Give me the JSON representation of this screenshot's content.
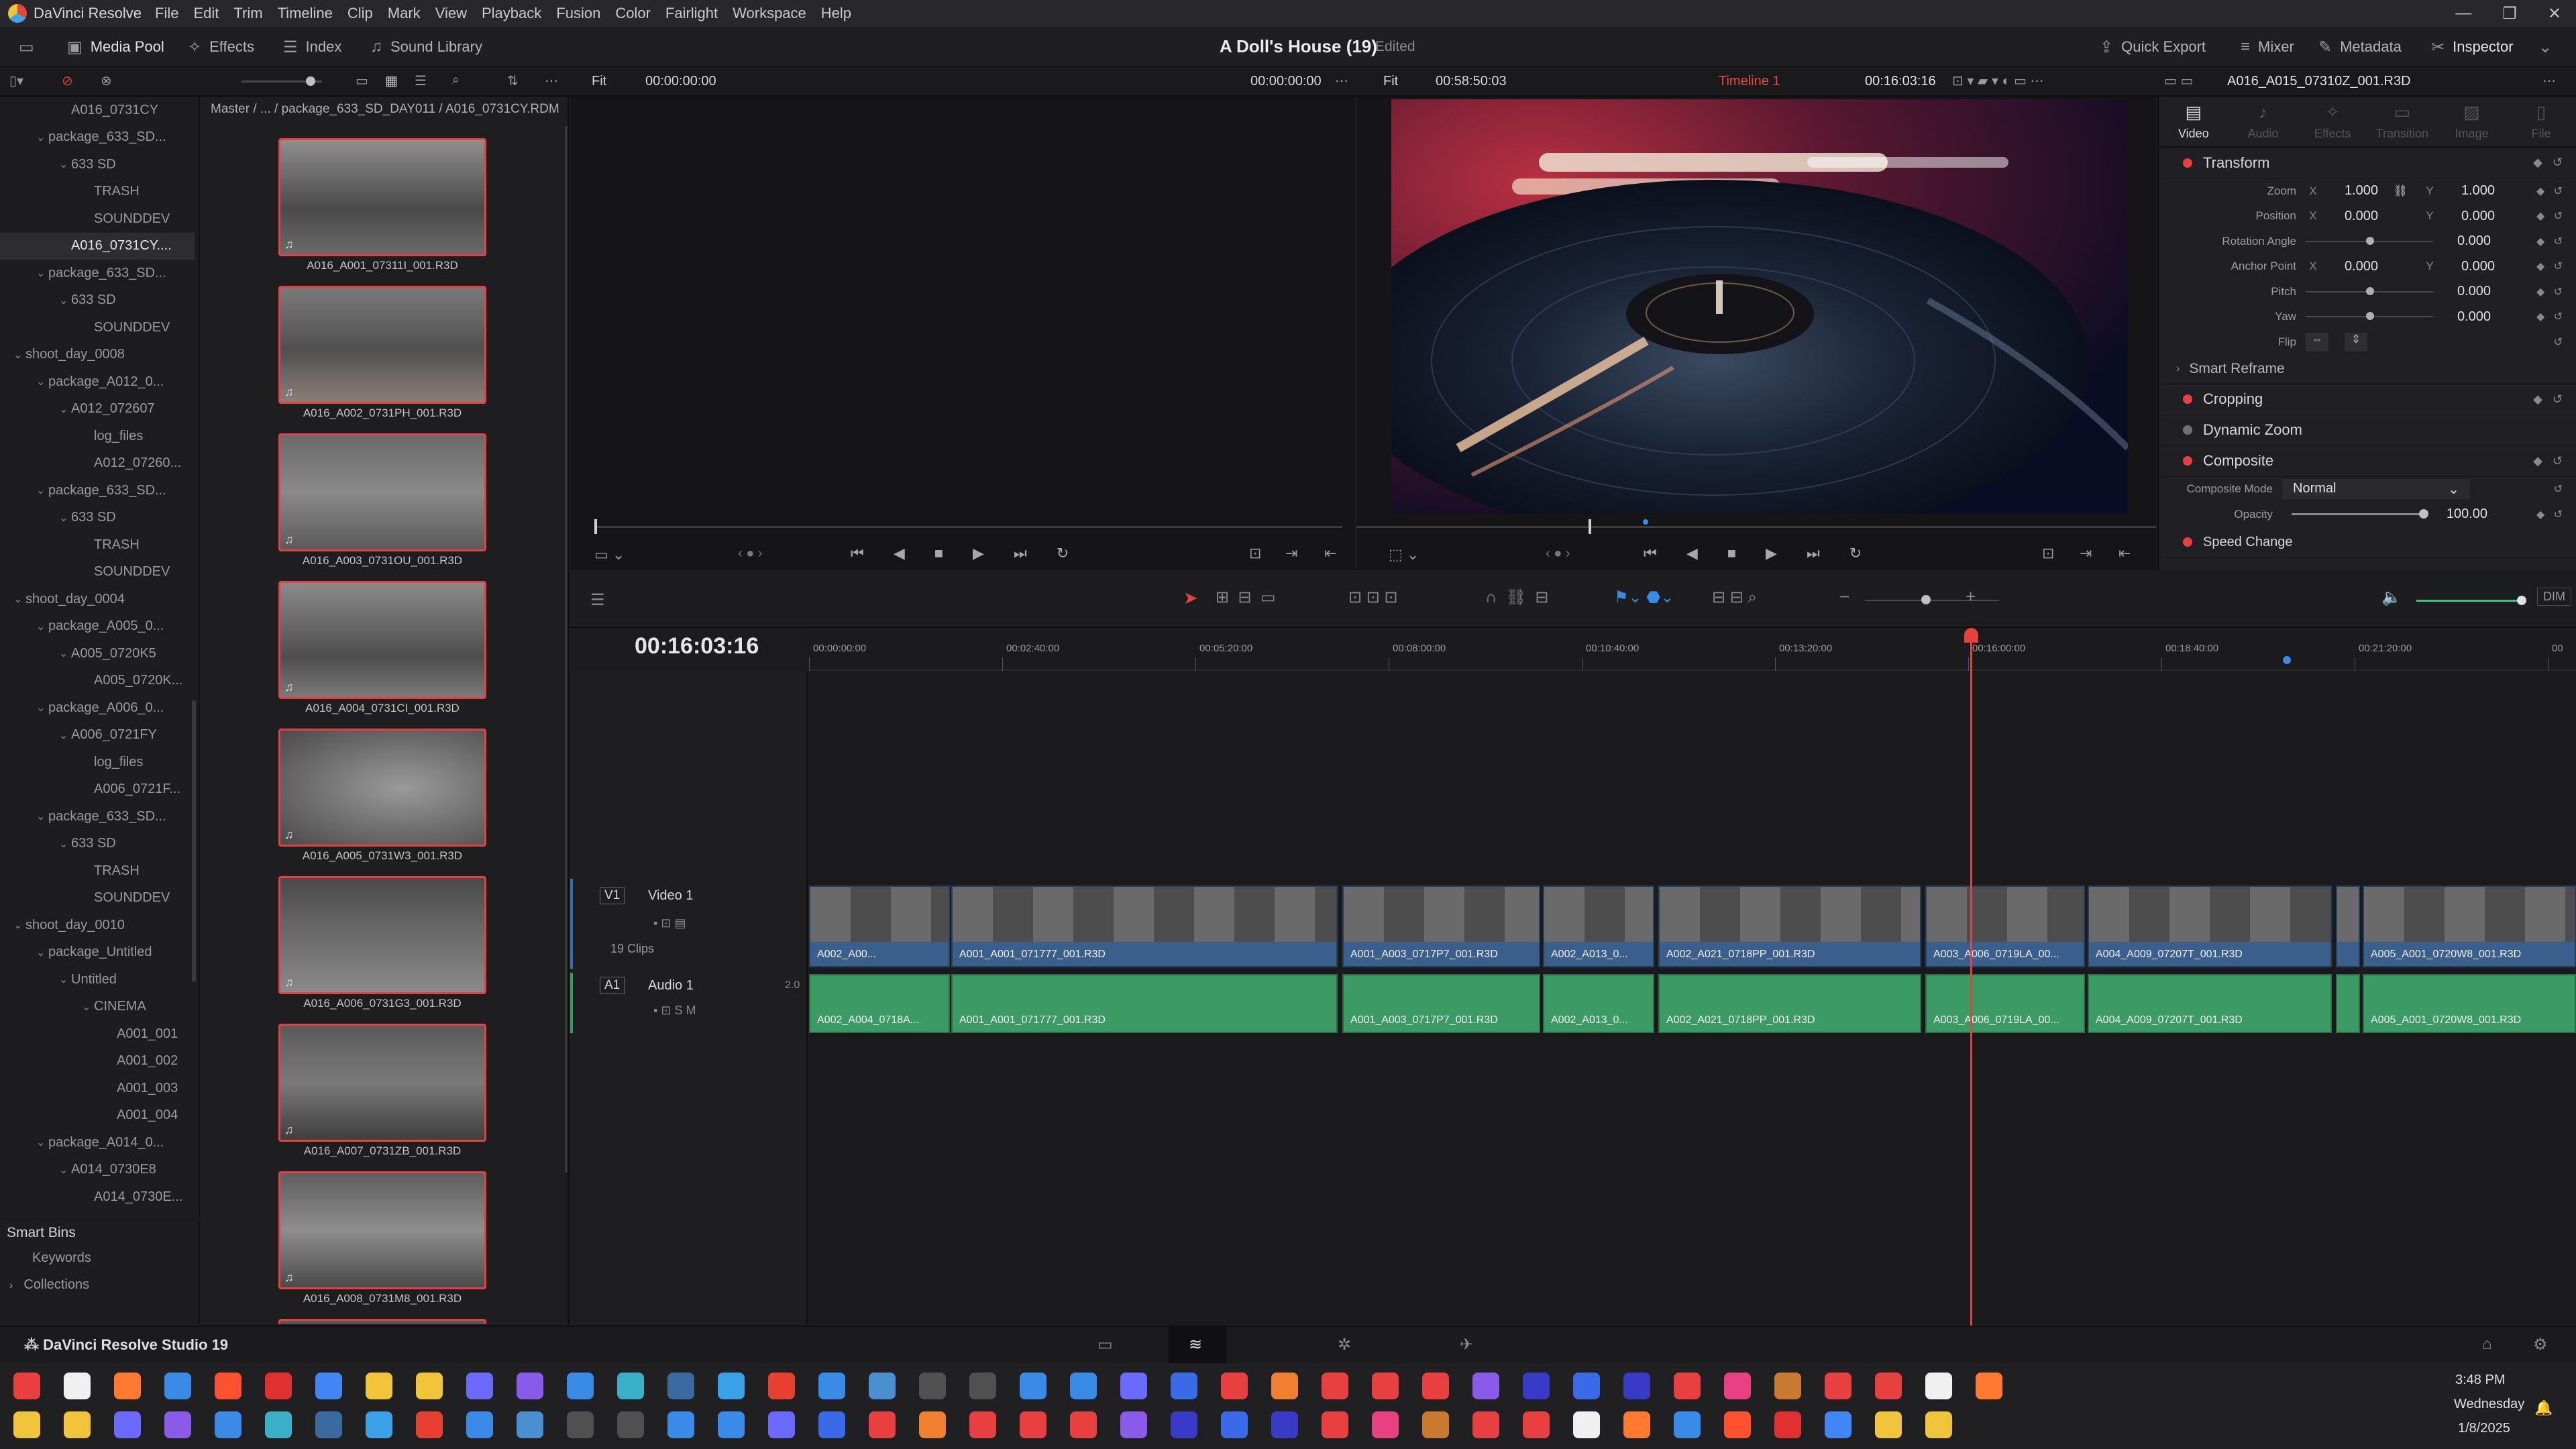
{
  "menubar": {
    "app_name": "DaVinci Resolve",
    "items": [
      "File",
      "Edit",
      "Trim",
      "Timeline",
      "Clip",
      "Mark",
      "View",
      "Playback",
      "Fusion",
      "Color",
      "Fairlight",
      "Workspace",
      "Help"
    ]
  },
  "toolbar": {
    "media_pool": "Media Pool",
    "effects": "Effects",
    "index": "Index",
    "sound_library": "Sound Library",
    "project_title": "A Doll's House (19)",
    "project_status": "Edited",
    "quick_export": "Quick Export",
    "mixer": "Mixer",
    "metadata": "Metadata",
    "inspector": "Inspector"
  },
  "viewer_header": {
    "source_fit": "Fit",
    "source_tc": "00:00:00:00",
    "source_duration": "00:00:00:00",
    "timeline_fit": "Fit",
    "timeline_duration": "00:58:50:03",
    "timeline_name": "Timeline 1",
    "timeline_tc": "00:16:03:16",
    "inspector_clip": "A016_A015_07310Z_001.R3D"
  },
  "bin_tree": [
    {
      "label": "A016_0731CY",
      "indent": 2
    },
    {
      "label": "package_633_SD...",
      "indent": 1,
      "caret": "v"
    },
    {
      "label": "633 SD",
      "indent": 2,
      "caret": "v"
    },
    {
      "label": "TRASH",
      "indent": 3
    },
    {
      "label": "SOUNDDEV",
      "indent": 3
    },
    {
      "label": "A016_0731CY....",
      "indent": 2,
      "selected": true
    },
    {
      "label": "package_633_SD...",
      "indent": 1,
      "caret": "v"
    },
    {
      "label": "633 SD",
      "indent": 2,
      "caret": "v"
    },
    {
      "label": "SOUNDDEV",
      "indent": 3
    },
    {
      "label": "shoot_day_0008",
      "indent": 0,
      "caret": "v"
    },
    {
      "label": "package_A012_0...",
      "indent": 1,
      "caret": "v"
    },
    {
      "label": "A012_072607",
      "indent": 2,
      "caret": "v"
    },
    {
      "label": "log_files",
      "indent": 3
    },
    {
      "label": "A012_07260...",
      "indent": 3
    },
    {
      "label": "package_633_SD...",
      "indent": 1,
      "caret": "v"
    },
    {
      "label": "633 SD",
      "indent": 2,
      "caret": "v"
    },
    {
      "label": "TRASH",
      "indent": 3
    },
    {
      "label": "SOUNDDEV",
      "indent": 3
    },
    {
      "label": "shoot_day_0004",
      "indent": 0,
      "caret": "v"
    },
    {
      "label": "package_A005_0...",
      "indent": 1,
      "caret": "v"
    },
    {
      "label": "A005_0720K5",
      "indent": 2,
      "caret": "v"
    },
    {
      "label": "A005_0720K...",
      "indent": 3
    },
    {
      "label": "package_A006_0...",
      "indent": 1,
      "caret": "v"
    },
    {
      "label": "A006_0721FY",
      "indent": 2,
      "caret": "v"
    },
    {
      "label": "log_files",
      "indent": 3
    },
    {
      "label": "A006_0721F...",
      "indent": 3
    },
    {
      "label": "package_633_SD...",
      "indent": 1,
      "caret": "v"
    },
    {
      "label": "633 SD",
      "indent": 2,
      "caret": "v"
    },
    {
      "label": "TRASH",
      "indent": 3
    },
    {
      "label": "SOUNDDEV",
      "indent": 3
    },
    {
      "label": "shoot_day_0010",
      "indent": 0,
      "caret": "v"
    },
    {
      "label": "package_Untitled",
      "indent": 1,
      "caret": "v"
    },
    {
      "label": "Untitled",
      "indent": 2,
      "caret": "v"
    },
    {
      "label": "CINEMA",
      "indent": 3,
      "caret": "v"
    },
    {
      "label": "A001_001",
      "indent": 4
    },
    {
      "label": "A001_002",
      "indent": 4
    },
    {
      "label": "A001_003",
      "indent": 4
    },
    {
      "label": "A001_004",
      "indent": 4
    },
    {
      "label": "package_A014_0...",
      "indent": 1,
      "caret": "v"
    },
    {
      "label": "A014_0730E8",
      "indent": 2,
      "caret": "v"
    },
    {
      "label": "A014_0730E...",
      "indent": 3
    }
  ],
  "smart_bins": {
    "title": "Smart Bins",
    "keywords": "Keywords",
    "collections": "Collections"
  },
  "media_pool": {
    "breadcrumb": "Master /   ...   / package_633_SD_DAY011 / A016_0731CY.RDM",
    "clips": [
      "A016_A001_07311I_001.R3D",
      "A016_A002_0731PH_001.R3D",
      "A016_A003_0731OU_001.R3D",
      "A016_A004_0731CI_001.R3D",
      "A016_A005_0731W3_001.R3D",
      "A016_A006_0731G3_001.R3D",
      "A016_A007_0731ZB_001.R3D",
      "A016_A008_0731M8_001.R3D"
    ]
  },
  "inspector": {
    "tabs": [
      "Video",
      "Audio",
      "Effects",
      "Transition",
      "Image",
      "File"
    ],
    "transform": "Transform",
    "zoom_label": "Zoom",
    "zoom_x": "1.000",
    "zoom_y": "1.000",
    "position_label": "Position",
    "pos_x": "0.000",
    "pos_y": "0.000",
    "rotation_label": "Rotation Angle",
    "rotation": "0.000",
    "anchor_label": "Anchor Point",
    "anchor_x": "0.000",
    "anchor_y": "0.000",
    "pitch_label": "Pitch",
    "pitch": "0.000",
    "yaw_label": "Yaw",
    "yaw": "0.000",
    "flip_label": "Flip",
    "smart_reframe": "Smart Reframe",
    "cropping": "Cropping",
    "dynamic_zoom": "Dynamic Zoom",
    "composite": "Composite",
    "composite_mode_label": "Composite Mode",
    "composite_mode": "Normal",
    "opacity_label": "Opacity",
    "opacity": "100.00",
    "speed_change": "Speed Change",
    "x": "X",
    "y": "Y"
  },
  "timeline": {
    "current_tc": "00:16:03:16",
    "ruler": [
      "00:00:00:00",
      "00:02:40:00",
      "00:05:20:00",
      "00:08:00:00",
      "00:10:40:00",
      "00:13:20:00",
      "00:16:00:00",
      "00:18:40:00",
      "00:21:20:00",
      "00"
    ],
    "v1_tag": "V1",
    "v1_name": "Video 1",
    "clip_count": "19 Clips",
    "a1_tag": "A1",
    "a1_name": "Audio 1",
    "a1_level": "2.0",
    "dim": "DIM",
    "video_clips": [
      "A002_A00...",
      "A001_A001_071777_001.R3D",
      "A001_A003_0717P7_001.R3D",
      "A002_A013_0...",
      "A002_A021_0718PP_001.R3D",
      "A003_A006_0719LA_00...",
      "A004_A009_07207T_001.R3D",
      "",
      "A005_A001_0720W8_001.R3D"
    ],
    "audio_clips": [
      "A002_A004_0718A...",
      "A001_A001_071777_001.R3D",
      "A001_A003_0717P7_001.R3D",
      "A002_A013_0...",
      "A002_A021_0718PP_001.R3D",
      "A003_A006_0719LA_00...",
      "A004_A009_07207T_001.R3D",
      "",
      "A005_A001_0720W8_001.R3D"
    ]
  },
  "statusbar": {
    "app": "DaVinci Resolve Studio 19"
  },
  "taskbar": {
    "time": "3:48 PM",
    "day": "Wednesday",
    "date": "1/8/2025"
  }
}
